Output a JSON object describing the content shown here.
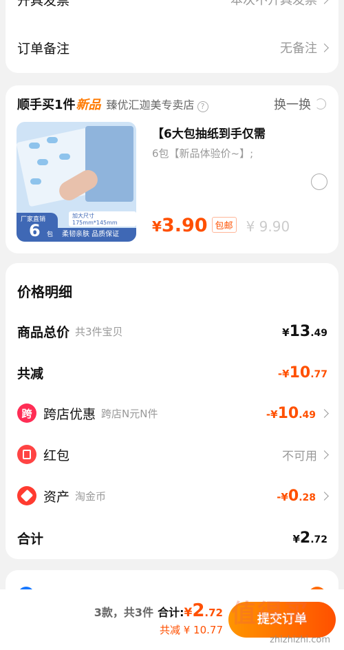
{
  "invoice": {
    "label": "开具发票",
    "value": "本次不开具发票"
  },
  "remark": {
    "label": "订单备注",
    "value": "无备注"
  },
  "promo": {
    "title": "顺手买1件",
    "new_tag": "新品",
    "store": "臻优汇迦美专卖店",
    "help": "?",
    "swap_label": "换一换",
    "product": {
      "title": "【6大包抽纸到手仅需",
      "subtitle": "6包【新品体验价~】;",
      "price_symbol": "¥",
      "price": "3.90",
      "free_shipping": "包邮",
      "original_price": "¥ 9.90",
      "thumb": {
        "badge_small": "厂家直销",
        "badge_number": "6",
        "badge_unit": "包",
        "size_tag": "加大尺寸175mm*145mm",
        "strip_text": "柔韧亲肤 品质保证"
      }
    }
  },
  "price_details": {
    "title": "价格明细",
    "rows": {
      "goods_total": {
        "label": "商品总价",
        "sub": "共3件宝贝",
        "sym": "¥",
        "big": "13",
        "small": ".49"
      },
      "total_discount": {
        "label": "共减",
        "sym": "-¥",
        "big": "10",
        "small": ".77"
      },
      "cross_store": {
        "icon_text": "跨",
        "label": "跨店优惠",
        "sub": "跨店N元N件",
        "sym": "-¥",
        "big": "10",
        "small": ".49"
      },
      "red_packet": {
        "label": "红包",
        "value": "不可用"
      },
      "assets": {
        "label": "资产",
        "sub": "淘金币",
        "sym": "-¥",
        "big": "0",
        "small": ".28"
      },
      "total": {
        "label": "合计",
        "sym": "¥",
        "big": "2",
        "small": ".72"
      }
    }
  },
  "bottom_bar": {
    "count": "3款，共3件",
    "total_label": "合计:",
    "total_sym": "¥",
    "total_big": "2",
    "total_small": ".72",
    "saved": "共减 ¥ 10.77",
    "submit_label": "提交订单",
    "watermark": "值得买",
    "watermark_url": "zhizhizhi.com"
  },
  "colors": {
    "accent": "#ff5000",
    "orange": "#ff7a00",
    "gray": "#999999"
  }
}
